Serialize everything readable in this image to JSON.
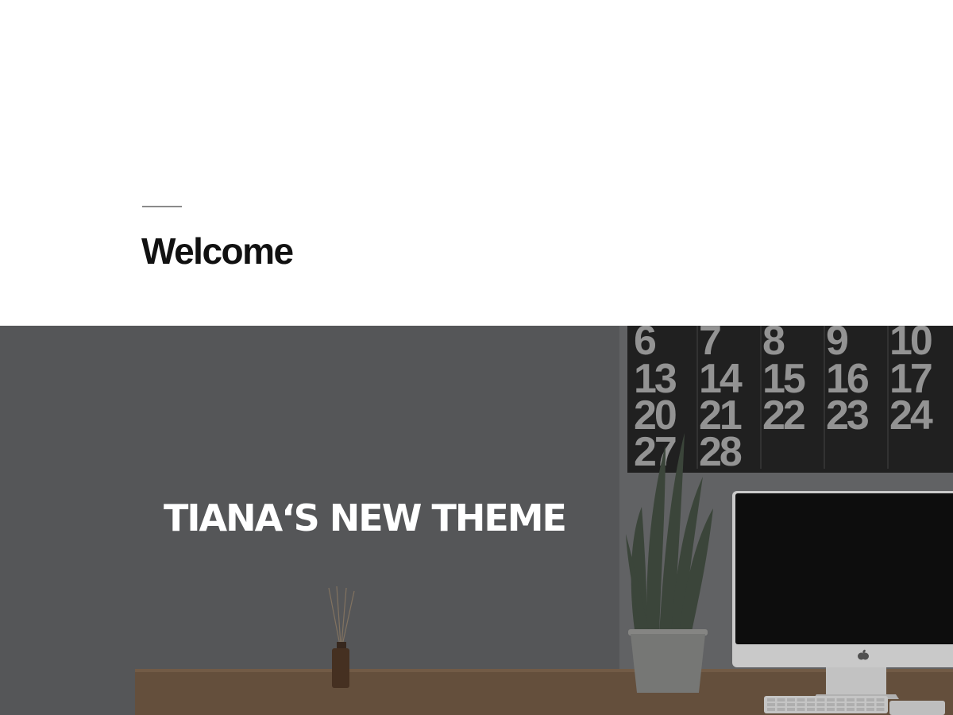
{
  "page": {
    "title": "Welcome"
  },
  "hero": {
    "title": "TIANA‘S NEW THEME",
    "overlay_color": "#58595b",
    "calendar": {
      "rows": [
        [
          "6",
          "7",
          "8",
          "9",
          "10"
        ],
        [
          "13",
          "14",
          "15",
          "16",
          "17"
        ],
        [
          "20",
          "21",
          "22",
          "23",
          "24"
        ],
        [
          "27",
          "28",
          "",
          "",
          ""
        ]
      ]
    },
    "icons": [
      "apple-logo-icon"
    ]
  }
}
